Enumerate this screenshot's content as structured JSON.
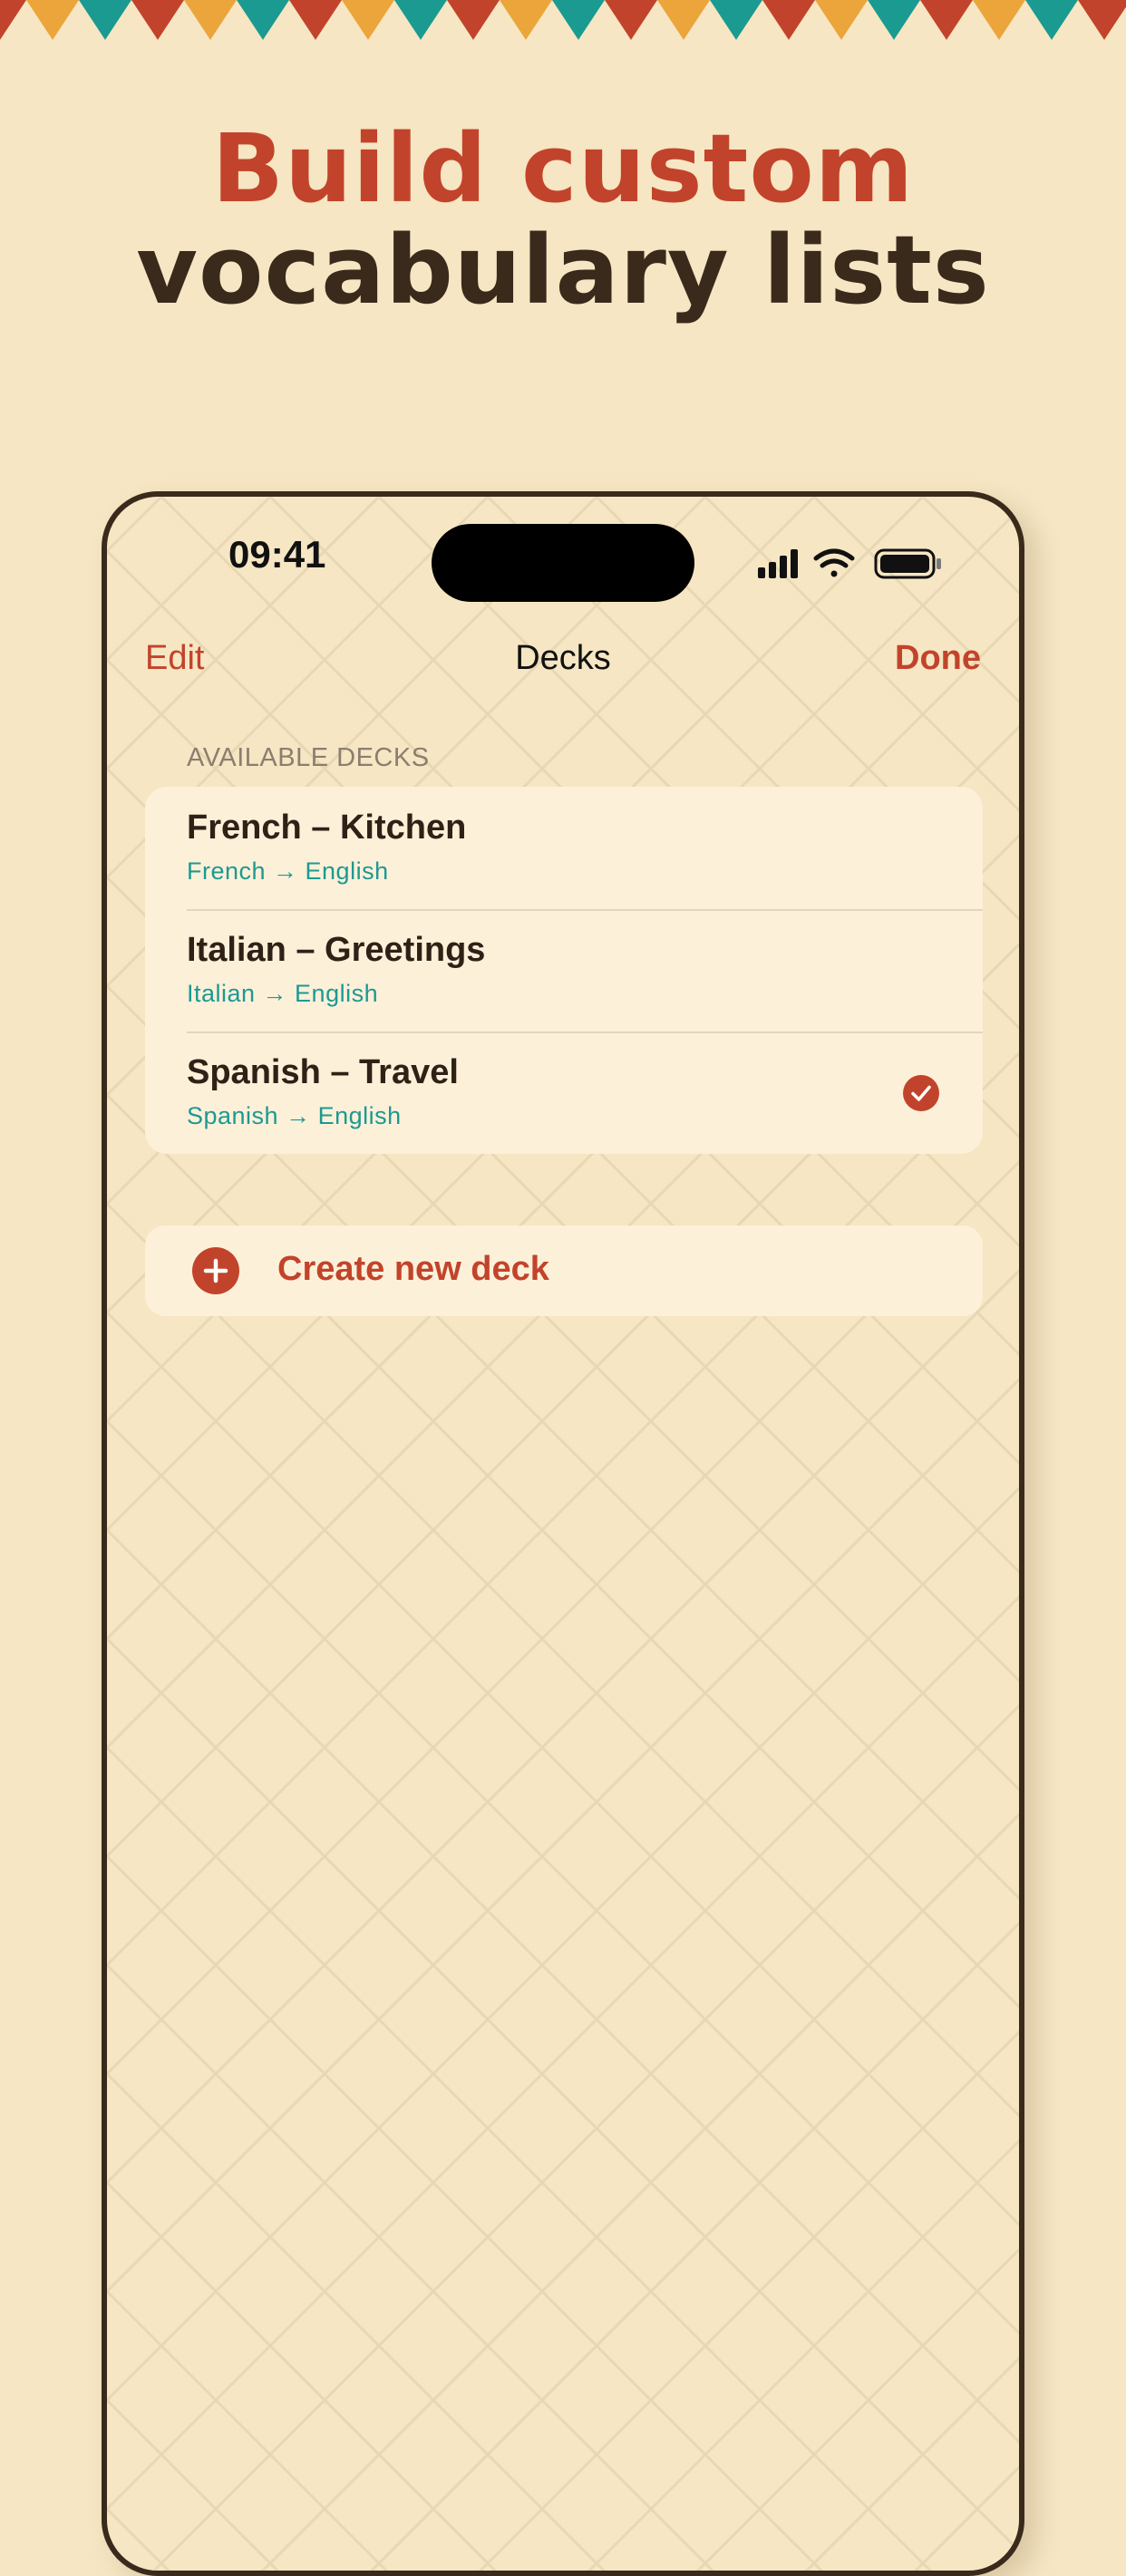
{
  "colors": {
    "background": "#f6e6c3",
    "accent_red": "#c2432b",
    "dark_brown": "#3a2a1c",
    "teal": "#1b9a91",
    "orange": "#eba53a",
    "card": "#fdf0d9"
  },
  "bunting": {
    "pattern": [
      "red",
      "orange",
      "teal"
    ]
  },
  "headline": {
    "line1": "Build custom",
    "line2": "vocabulary lists"
  },
  "status_bar": {
    "time": "09:41",
    "icons": [
      "signal-icon",
      "wifi-icon",
      "battery-icon"
    ]
  },
  "nav": {
    "left": "Edit",
    "title": "Decks",
    "right": "Done"
  },
  "section": {
    "header": "AVAILABLE DECKS"
  },
  "decks": [
    {
      "title": "French – Kitchen",
      "subtitle": "French → English",
      "selected": false
    },
    {
      "title": "Italian – Greetings",
      "subtitle": "Italian → English",
      "selected": false
    },
    {
      "title": "Spanish – Travel",
      "subtitle": "Spanish → English",
      "selected": true
    }
  ],
  "create_button": {
    "label": "Create new deck",
    "icon": "plus-circle-icon"
  }
}
